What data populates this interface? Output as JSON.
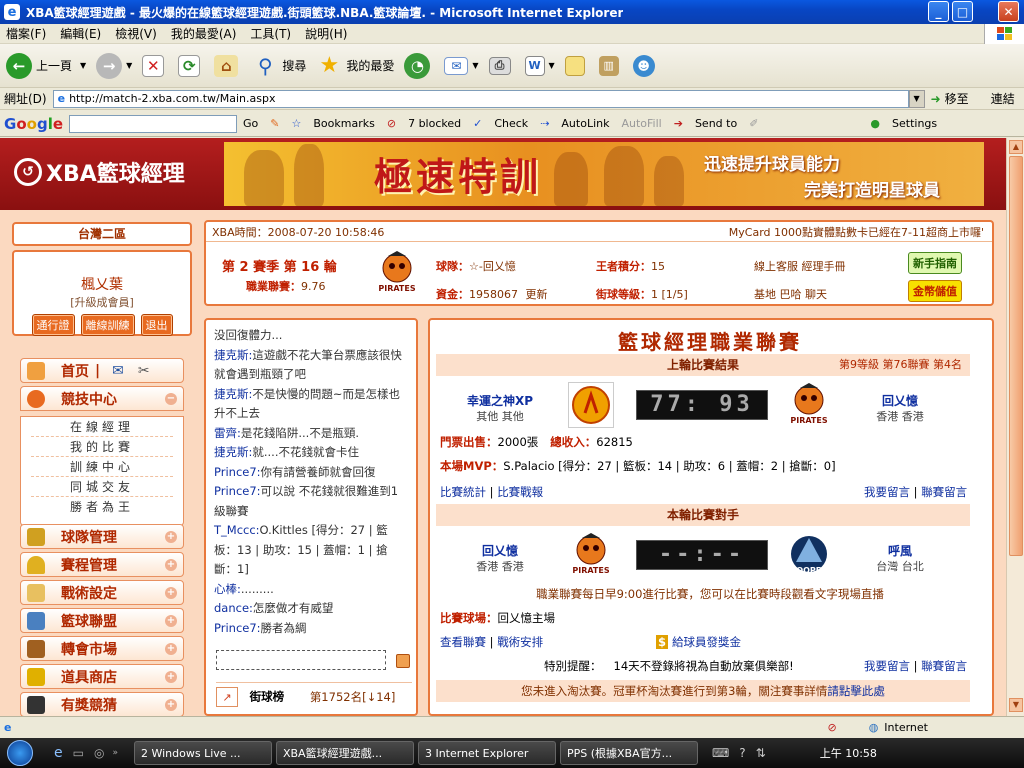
{
  "window": {
    "title": "XBA籃球經理遊戲 - 最火爆的在線籃球經理遊戲.街頭籃球.NBA.籃球論壇. - Microsoft Internet Explorer"
  },
  "menu": [
    "檔案(F)",
    "編輯(E)",
    "檢視(V)",
    "我的最愛(A)",
    "工具(T)",
    "說明(H)"
  ],
  "toolbar": {
    "back": "上一頁",
    "search": "搜尋",
    "favorites": "我的最愛"
  },
  "address": {
    "label": "網址(D)",
    "url": "http://match-2.xba.com.tw/Main.aspx",
    "go": "移至",
    "links": "連結"
  },
  "googlebar": {
    "logo": "Google",
    "go": "Go",
    "bookmarks": "Bookmarks",
    "blocked": "7 blocked",
    "check": "Check",
    "autolink": "AutoLink",
    "autofill": "AutoFill",
    "sendto": "Send to",
    "settings": "Settings"
  },
  "site": {
    "logo": "XBA籃球經理",
    "banner": {
      "big": "極速特訓",
      "line1": "迅速提升球員能力",
      "line2": "完美打造明星球員"
    },
    "zone": "台灣二區",
    "user": {
      "name": "楓乂葉",
      "rank": "[升級成會員]",
      "btn1": "通行證",
      "btn2": "離線訓練",
      "btn3": "退出"
    },
    "nav": {
      "home": "首页",
      "arena": "競技中心",
      "sub": [
        "在線經理",
        "我的比賽",
        "訓練中心",
        "同城交友",
        "勝者為王"
      ],
      "team": "球隊管理",
      "schedule": "賽程管理",
      "tactics": "戰術設定",
      "alliance": "籃球聯盟",
      "market": "轉會市場",
      "shop": "道具商店",
      "reward": "有獎競猜"
    },
    "info": {
      "time": "XBA時間：2008-07-20 10:58:46",
      "marquee": "MyCard 1000點實體點數卡已經在7-11超商上市囉'",
      "season": "第 2 賽季  第 16 輪",
      "league_label": "職業聯賽：",
      "league_val": "9.76",
      "team_label": "球隊：",
      "team_val": "☆-回乂憶",
      "king_label": "王者積分：",
      "king_val": "15",
      "service": "線上客服  經理手冊",
      "funds_label": "資金：",
      "funds_val": "1958067",
      "update": "更新",
      "level_label": "街球等級：",
      "level_val": "1 [1/5]",
      "base": "基地  巴哈  聊天",
      "guide_btn": "新手指南",
      "deposit_btn": "金幣儲值",
      "pirates": "PIRATES"
    },
    "chat": [
      {
        "name": "",
        "text": "没回復體力..."
      },
      {
        "name": "捷克斯:",
        "text": "這遊戲不花大筆台票應該很快就會遇到瓶頸了吧"
      },
      {
        "name": "捷克斯:",
        "text": "不是快慢的問題~而是怎樣也升不上去"
      },
      {
        "name": "雷齊:",
        "text": "是花錢陷阱...不是瓶頸."
      },
      {
        "name": "捷克斯:",
        "text": "就....不花錢就會卡住"
      },
      {
        "name": "Prince7:",
        "text": "你有請營養師就會回復"
      },
      {
        "name": "Prince7:",
        "text": "可以說 不花錢就很難進到1級聯賽"
      },
      {
        "name": "T_Mccc:",
        "text": "O.Kittles [得分：27 | 籃板：13 | 助攻：15 | 蓋帽：1 | 搶斷：1]"
      },
      {
        "name": "心棒:",
        "text": "........."
      },
      {
        "name": "dance:",
        "text": "怎麼做才有威望"
      },
      {
        "name": "Prince7:",
        "text": "勝者為綢"
      }
    ],
    "rank": {
      "title": "街球榜",
      "value": "第1752名[↓14]"
    },
    "league": {
      "title": "籃球經理職業聯賽",
      "last_header": "上輪比賽結果",
      "last_meta": "第9等級  第76聯賽  第4名",
      "home_team": "幸運之神XP",
      "home_loc": "其他  其他",
      "score": "77: 93",
      "away_team": "回乂憶",
      "away_loc": "香港  香港",
      "tickets_label": "門票出售：",
      "tickets_val": "2000張",
      "income_label": "總收入：",
      "income_val": "62815",
      "mvp_label": "本場MVP：",
      "mvp_val": "S.Palacio [得分：27 | 籃板：14 | 助攻：6 | 蓋帽：2 | 搶斷：0]",
      "stats_link": "比賽統計",
      "report_link": "比賽戰報",
      "msg_link": "我要留言",
      "league_msg_link": "聯賽留言",
      "next_header": "本輪比賽對手",
      "next_home": "回乂憶",
      "next_home_loc": "香港  香港",
      "next_score": "--:--",
      "next_away": "呼風",
      "next_away_loc": "台灣  台北",
      "notice": "職業聯賽每日早9:00進行比賽，您可以在比賽時段觀看文字現場直播",
      "venue_label": "比賽球場：",
      "venue_val": "回乂憶主場",
      "view_league": "查看聯賽",
      "tactics_link": "戰術安排",
      "bonus": "給球員發獎金",
      "remind_label": "特別提醒：",
      "remind_val": "14天不登錄將視為自動放棄俱樂部!",
      "msg_link2": "我要留言",
      "league_msg_link2": "聯賽留言",
      "bottom_notice": "您未進入淘汰賽。冠軍杯淘汰賽進行到第3輪，關注賽事詳情",
      "bottom_link": "請點擊此處",
      "logo_pirates": "PIRATES",
      "logo_sooper": "SOOPER"
    }
  },
  "status": {
    "zone": "Internet"
  },
  "taskbar": {
    "t1": "2 Windows Live ...",
    "t2": "XBA籃球經理遊戲...",
    "t3": "3 Internet Explorer",
    "t4": "PPS (根據XBA官方...",
    "clock": "上午 10:58"
  },
  "colors": {
    "accent": "#e8783c",
    "header": "#a01818",
    "link": "#1030a0"
  }
}
